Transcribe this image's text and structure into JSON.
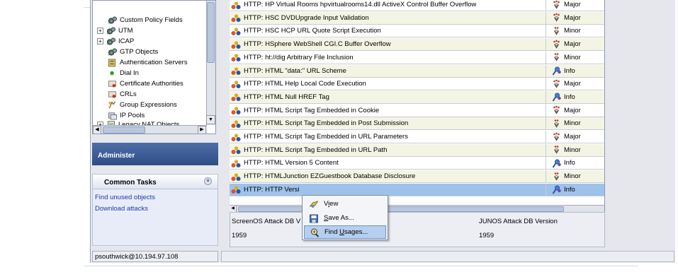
{
  "tree": {
    "items": [
      {
        "label": "Custom Policy Fields",
        "icon": "gear-icon",
        "expander": ""
      },
      {
        "label": "UTM",
        "icon": "gear-icon",
        "expander": "+"
      },
      {
        "label": "ICAP",
        "icon": "gear-icon",
        "expander": "+"
      },
      {
        "label": "GTP Objects",
        "icon": "gear-icon",
        "expander": ""
      },
      {
        "label": "Authentication Servers",
        "icon": "server-icon",
        "expander": ""
      },
      {
        "label": "Dial In",
        "icon": "green-dot-icon",
        "expander": ""
      },
      {
        "label": "Certificate Authorities",
        "icon": "certificate-icon",
        "expander": ""
      },
      {
        "label": "CRLs",
        "icon": "certificate-icon",
        "expander": ""
      },
      {
        "label": "Group Expressions",
        "icon": "group-expression-icon",
        "expander": ""
      },
      {
        "label": "IP Pools",
        "icon": "ip-pool-icon",
        "expander": ""
      },
      {
        "label": "Legacy NAT Objects",
        "icon": "nat-icon",
        "expander": "+"
      }
    ]
  },
  "panels": {
    "administer": "Administer",
    "common_tasks": "Common Tasks",
    "close_glyph": "×",
    "tasks": [
      "Find unused objects",
      "Download attacks"
    ]
  },
  "status": {
    "user": "psouthwick@10.194.97.108"
  },
  "attacks": {
    "rows": [
      {
        "name": "HTTP: HP Virtual Rooms hpvirtualrooms14.dll ActiveX Control Buffer Overflow",
        "severity": "Major"
      },
      {
        "name": "HTTP: HSC DVDUpgrade Input Validation",
        "severity": "Major"
      },
      {
        "name": "HTTP: HSC HCP URL Quote Script Execution",
        "severity": "Minor"
      },
      {
        "name": "HTTP: HSphere WebShell CGI.C Buffer Overflow",
        "severity": "Major"
      },
      {
        "name": "HTTP: ht://dig Arbitrary File Inclusion",
        "severity": "Minor"
      },
      {
        "name": "HTTP: HTML \"data:\" URL Scheme",
        "severity": "Info"
      },
      {
        "name": "HTTP: HTML Help Local Code Execution",
        "severity": "Major"
      },
      {
        "name": "HTTP: HTML Null HREF Tag",
        "severity": "Info"
      },
      {
        "name": "HTTP: HTML Script Tag Embedded in Cookie",
        "severity": "Major"
      },
      {
        "name": "HTTP: HTML Script Tag Embedded in Post Submission",
        "severity": "Minor"
      },
      {
        "name": "HTTP: HTML Script Tag Embedded in URL Parameters",
        "severity": "Major"
      },
      {
        "name": "HTTP: HTML Script Tag Embedded in URL Path",
        "severity": "Minor"
      },
      {
        "name": "HTTP: HTML Version 5 Content",
        "severity": "Info"
      },
      {
        "name": "HTTP: HTMLJunction EZGuestbook Database Disclosure",
        "severity": "Minor"
      },
      {
        "name": "HTTP: HTTP Versi",
        "severity": "Info"
      }
    ],
    "selected_row": 14
  },
  "details": {
    "screenos_label": "ScreenOS Attack DB V",
    "screenos_value": "1959",
    "junos_label": "JUNOS Attack DB Version",
    "junos_value": "1959"
  },
  "context_menu": {
    "items": [
      {
        "label": "View",
        "icon": "view-icon"
      },
      {
        "label": "Save As...",
        "icon": "save-icon"
      },
      {
        "label": "Find Usages...",
        "icon": "find-usages-icon"
      }
    ],
    "highlighted": 2
  },
  "colors": {
    "selection": "#9ec2ea",
    "alt_row": "#f4f4e4",
    "administer_bar": "#2e4c86",
    "link": "#1a3aa8"
  }
}
